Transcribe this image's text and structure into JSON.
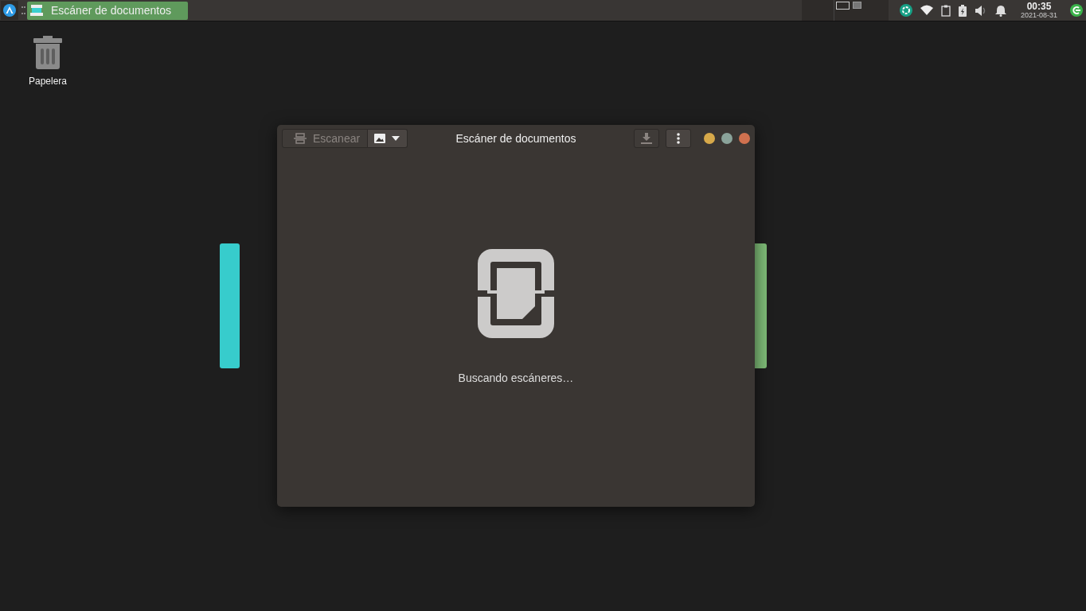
{
  "panel": {
    "tasks": [
      {
        "title": "Escáner de documentos",
        "selected": true
      }
    ],
    "workspaces": [
      {
        "selected": true
      },
      {
        "selected": false
      }
    ],
    "clock": {
      "time": "00:35",
      "date": "2021-08-31"
    }
  },
  "desktop_icons": [
    {
      "label": "Papelera"
    }
  ],
  "window": {
    "title": "Escáner de documentos",
    "scan_button": {
      "label": "Escanear",
      "disabled": true
    },
    "save_button": {
      "disabled": true
    },
    "status": "Buscando escáneres…"
  }
}
